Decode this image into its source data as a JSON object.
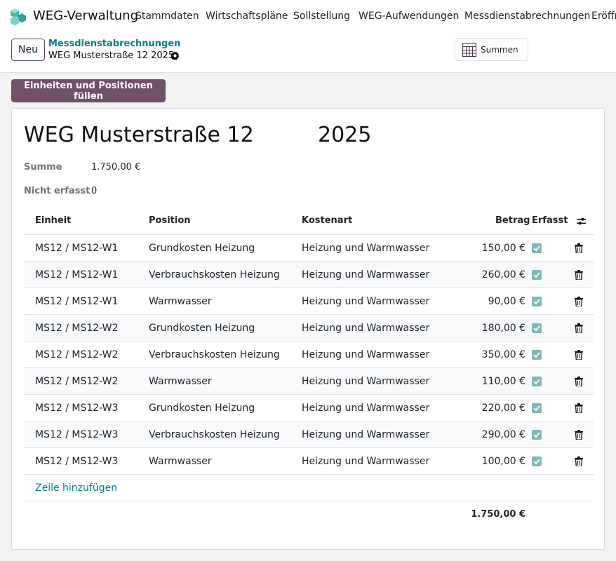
{
  "navbar": {
    "app_name": "WEG-Verwaltung",
    "menu": [
      "Stammdaten",
      "Wirtschaftspläne",
      "Sollstellung",
      "WEG-Aufwendungen",
      "Messdienstabrechnungen",
      "Eröffn"
    ]
  },
  "control_panel": {
    "new_label": "Neu",
    "breadcrumb": "Messdienstabrechnungen",
    "record_name": "WEG Musterstraße 12 2025",
    "summen_label": "Summen"
  },
  "action": {
    "fill_label": "Einheiten und Positionen füllen"
  },
  "form": {
    "title_name": "WEG Musterstraße 12",
    "title_year": "2025",
    "summe_label": "Summe",
    "summe_value": "1.750,00 €",
    "nicht_erfasst_label": "Nicht erfasst",
    "nicht_erfasst_value": "0"
  },
  "table": {
    "headers": {
      "einheit": "Einheit",
      "position": "Position",
      "kostenart": "Kostenart",
      "betrag": "Betrag",
      "erfasst": "Erfasst"
    },
    "rows": [
      {
        "einheit": "MS12 / MS12-W1",
        "position": "Grundkosten Heizung",
        "kostenart": "Heizung und Warmwasser",
        "betrag": "150,00 €",
        "erfasst": true
      },
      {
        "einheit": "MS12 / MS12-W1",
        "position": "Verbrauchskosten Heizung",
        "kostenart": "Heizung und Warmwasser",
        "betrag": "260,00 €",
        "erfasst": true
      },
      {
        "einheit": "MS12 / MS12-W1",
        "position": "Warmwasser",
        "kostenart": "Heizung und Warmwasser",
        "betrag": "90,00 €",
        "erfasst": true
      },
      {
        "einheit": "MS12 / MS12-W2",
        "position": "Grundkosten Heizung",
        "kostenart": "Heizung und Warmwasser",
        "betrag": "180,00 €",
        "erfasst": true
      },
      {
        "einheit": "MS12 / MS12-W2",
        "position": "Verbrauchskosten Heizung",
        "kostenart": "Heizung und Warmwasser",
        "betrag": "350,00 €",
        "erfasst": true
      },
      {
        "einheit": "MS12 / MS12-W2",
        "position": "Warmwasser",
        "kostenart": "Heizung und Warmwasser",
        "betrag": "110,00 €",
        "erfasst": true
      },
      {
        "einheit": "MS12 / MS12-W3",
        "position": "Grundkosten Heizung",
        "kostenart": "Heizung und Warmwasser",
        "betrag": "220,00 €",
        "erfasst": true
      },
      {
        "einheit": "MS12 / MS12-W3",
        "position": "Verbrauchskosten Heizung",
        "kostenart": "Heizung und Warmwasser",
        "betrag": "290,00 €",
        "erfasst": true
      },
      {
        "einheit": "MS12 / MS12-W3",
        "position": "Warmwasser",
        "kostenart": "Heizung und Warmwasser",
        "betrag": "100,00 €",
        "erfasst": true
      }
    ],
    "add_line_label": "Zeile hinzufügen",
    "total": "1.750,00 €"
  },
  "colors": {
    "accent": "#71506b",
    "link": "#017e84",
    "checkbox": "#7fb8b6"
  }
}
